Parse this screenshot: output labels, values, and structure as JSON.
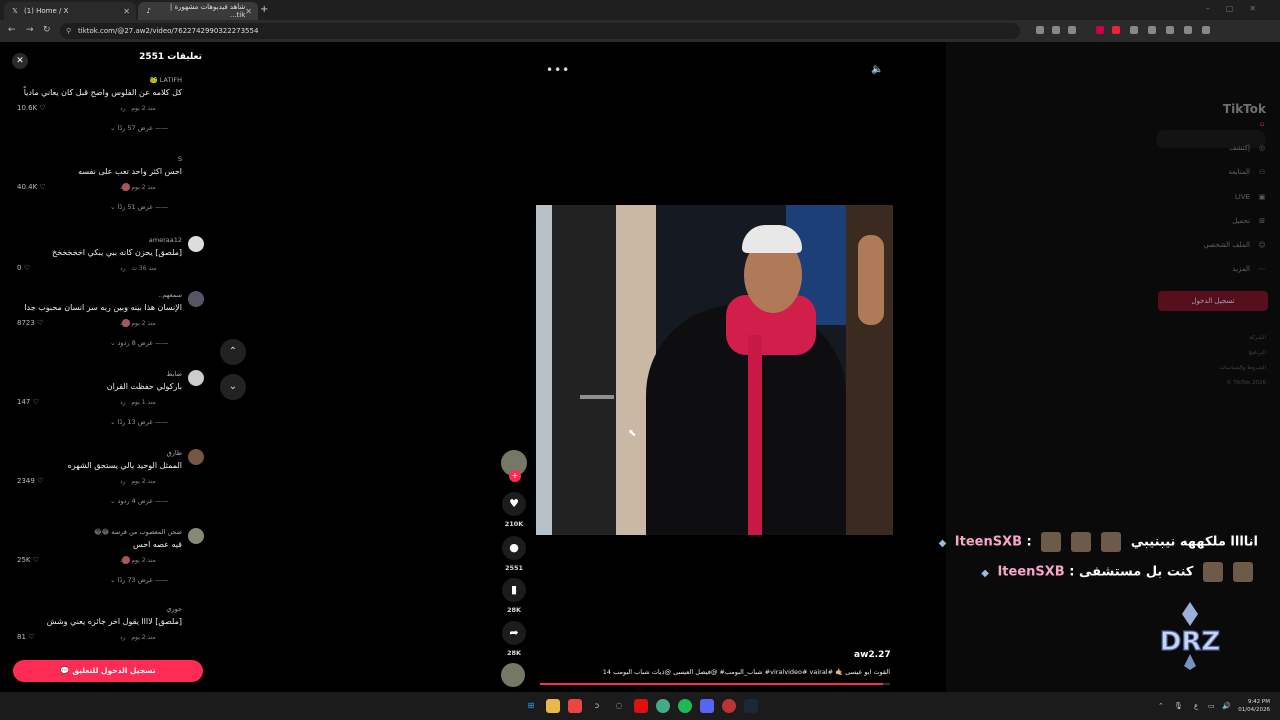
{
  "browser": {
    "tabs": [
      {
        "title": "(1) Home / X",
        "icon": "x-logo-icon"
      },
      {
        "title": "شاهد فيديوهات مشهورة | tik...",
        "icon": "tiktok-icon"
      }
    ],
    "new_tab": "+",
    "url": "tiktok.com/@27.aw2/video/7622742990322273554"
  },
  "comments_panel": {
    "title": "تعليقات 2551",
    "close": "✕",
    "reply_label": "رد",
    "comments": [
      {
        "user": "LATIFH 🐸",
        "text": "كل كلامه عن الفلوس واضح قبل كان يعاني مادياً",
        "likes": "10.6K",
        "time": "منذ 2 يوم",
        "replies": "عرض 57 ردًا"
      },
      {
        "user": "S",
        "text": "احس اكثر واحد تعب على نفسه",
        "likes": "40.4K",
        "time": "منذ 2 يوم",
        "replies": "عرض 51 ردًا"
      },
      {
        "user": "ameraa12",
        "text": "[ملصق] يحزن كانه ببي يبكي اخخخخخخ",
        "likes": "0",
        "time": "منذ 36 ث",
        "replies": ""
      },
      {
        "user": "سمعهم..",
        "text": "الإنسان هذا بينه وبين ربه سر انسان محبوب جدا",
        "likes": "8723",
        "time": "منذ 2 يوم",
        "replies": "عرض 8 ردود"
      },
      {
        "user": "ضابط",
        "text": "باركولي حفظت القران",
        "likes": "147",
        "time": "منذ 1 يوم",
        "replies": "عرض 13 ردًا"
      },
      {
        "user": "طارق",
        "text": "الممثل الوحيد يالي يستحق الشهره",
        "likes": "2349",
        "time": "منذ 2 يوم",
        "replies": "عرض 4 ردود"
      },
      {
        "user": "صحن المعصوب من قرسه 😂😂",
        "text": "فيه عصه احس",
        "likes": "25K",
        "time": "منذ 2 يوم",
        "replies": "عرض 73 ردًا"
      },
      {
        "user": "جوري",
        "text": "[ملصق] لاااا يقول اخر جائزه يعني وشش",
        "likes": "81",
        "time": "منذ 2 يوم",
        "replies": ""
      }
    ],
    "login_button": "تسجيل الدخول للتعليق"
  },
  "player": {
    "more": "•••",
    "likes": "210K",
    "comments": "2551",
    "saves": "28K",
    "shares": "28K",
    "author": "aw2.27",
    "caption": "القوت ابو عيسى 🤙🏼 #viralvideo# vairal# شباب_البومب# @فيصل العيسى @ذيات شباب البومب 14",
    "progress": 0.98
  },
  "tiktok_nav": {
    "logo": "TikTok",
    "items": [
      "إكتشف",
      "المتابعة",
      "LIVE",
      "تحميل",
      "الملف الشخصي",
      "المزيد"
    ],
    "login": "تسجيل الدخول",
    "footer": [
      "الشركة",
      "البرنامج",
      "الشروط والسياسات",
      "TikTok 2026 ©"
    ]
  },
  "stream_chat": [
    {
      "name": "IteenSXB",
      "message": "اناااا ملكههه نيبنيبي"
    },
    {
      "name": "IteenSXB",
      "message": "كنت بل مستشفى"
    }
  ],
  "overlay_logo": "DRZ",
  "taskbar": {
    "time": "9:42 PM",
    "date": "01/04/2026",
    "lang": "ع"
  }
}
